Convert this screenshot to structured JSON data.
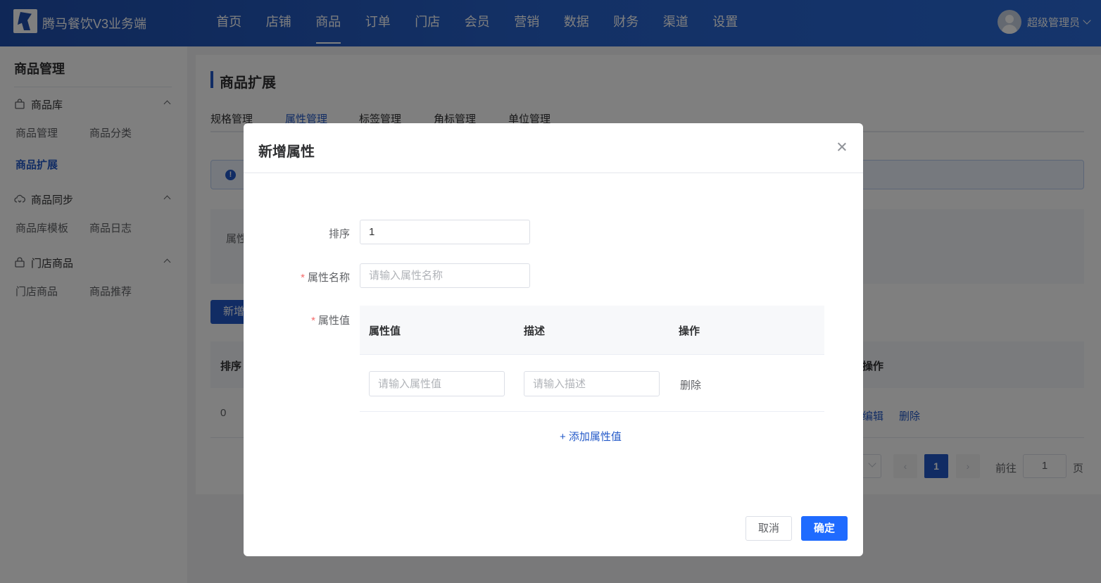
{
  "app": {
    "title": "腾马餐饮V3业务端"
  },
  "nav": {
    "items": [
      "首页",
      "店铺",
      "商品",
      "订单",
      "门店",
      "会员",
      "营销",
      "数据",
      "财务",
      "渠道",
      "设置"
    ],
    "active": "商品"
  },
  "user": {
    "name": "超级管理员"
  },
  "sidebar": {
    "title": "商品管理",
    "groups": [
      {
        "label": "商品库",
        "icon": "bag-icon",
        "items": [
          "商品管理",
          "商品分类",
          "商品扩展"
        ]
      },
      {
        "label": "商品同步",
        "icon": "cloud-sync-icon",
        "items": [
          "商品库模板",
          "商品日志"
        ]
      },
      {
        "label": "门店商品",
        "icon": "lock-bag-icon",
        "items": [
          "门店商品",
          "商品推荐"
        ]
      }
    ],
    "active_item": "商品扩展"
  },
  "page": {
    "title": "商品扩展",
    "tabs": [
      "规格管理",
      "属性管理",
      "标签管理",
      "角标管理",
      "单位管理"
    ],
    "active_tab": "属性管理",
    "filter_label_partial": "属性",
    "add_button_partial": "新增",
    "table": {
      "headers": {
        "sort": "排序",
        "actions": "操作"
      },
      "rows": [
        {
          "sort": "0",
          "edit": "编辑",
          "delete": "删除"
        }
      ]
    },
    "pagination": {
      "prev": "‹",
      "current": "1",
      "next": "›",
      "goto_label": "前往",
      "goto_value": "1",
      "unit": "页"
    }
  },
  "modal": {
    "title": "新增属性",
    "fields": {
      "sort": {
        "label": "排序",
        "value": "1"
      },
      "name": {
        "label": "属性名称",
        "required_mark": "*",
        "placeholder": "请输入属性名称"
      },
      "values": {
        "label": "属性值",
        "required_mark": "*"
      }
    },
    "value_table": {
      "headers": [
        "属性值",
        "描述",
        "操作"
      ],
      "row": {
        "value_placeholder": "请输入属性值",
        "desc_placeholder": "请输入描述",
        "delete": "删除"
      }
    },
    "add_value_link": "+ 添加属性值",
    "cancel": "取消",
    "confirm": "确定"
  },
  "colors": {
    "primary": "#2258c8",
    "confirm": "#1f6bff",
    "required": "#f56c6c",
    "topbar": "#2762cc"
  }
}
